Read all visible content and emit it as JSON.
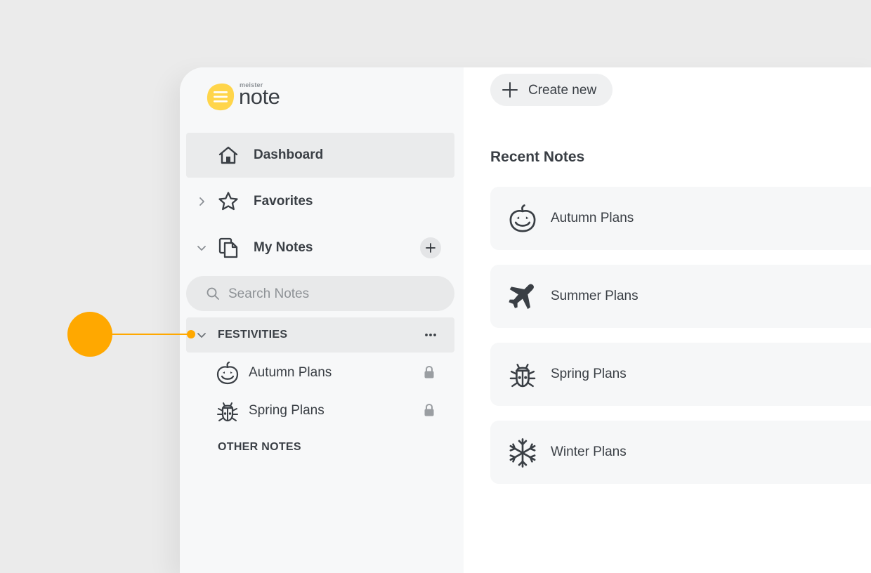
{
  "app": {
    "logo_small": "meister",
    "logo_word": "note"
  },
  "colors": {
    "accent": "#ffa800",
    "logo_yellow": "#ffd54a",
    "text": "#3a3f45"
  },
  "sidebar": {
    "nav": [
      {
        "label": "Dashboard",
        "icon": "home-icon",
        "active": true
      },
      {
        "label": "Favorites",
        "icon": "star-icon",
        "expanded": false
      },
      {
        "label": "My Notes",
        "icon": "notes-icon",
        "expanded": true
      }
    ],
    "search": {
      "placeholder": "Search Notes",
      "value": ""
    },
    "folders": [
      {
        "label": "FESTIVITIES",
        "expanded": true,
        "notes": [
          {
            "label": "Autumn Plans",
            "icon": "pumpkin-icon",
            "locked": true
          },
          {
            "label": "Spring Plans",
            "icon": "bug-icon",
            "locked": true
          }
        ]
      }
    ],
    "other_section": "OTHER NOTES"
  },
  "main": {
    "create_label": "Create new",
    "recent_title": "Recent Notes",
    "recent": [
      {
        "label": "Autumn Plans",
        "icon": "pumpkin-icon"
      },
      {
        "label": "Summer Plans",
        "icon": "airplane-icon"
      },
      {
        "label": "Spring Plans",
        "icon": "bug-icon"
      },
      {
        "label": "Winter Plans",
        "icon": "snowflake-icon"
      }
    ]
  }
}
